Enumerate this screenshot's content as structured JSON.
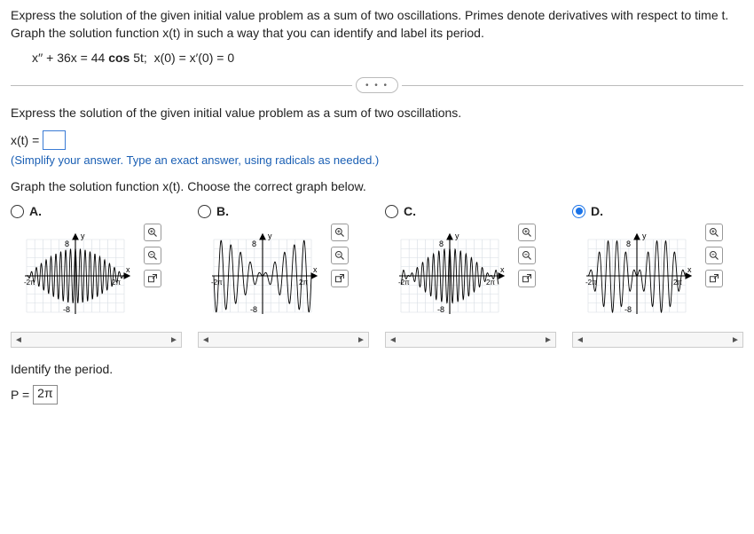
{
  "problem": {
    "statement": "Express the solution of the given initial value problem as a sum of two oscillations. Primes denote derivatives with respect to time t. Graph the solution function x(t) in such a way that you can identify and label its period.",
    "equation": "x′′ + 36x = 44 cos 5t;  x(0) = x′(0) = 0"
  },
  "more_indicator": "• • •",
  "part1": {
    "prompt": "Express the solution of the given initial value problem as a sum of two oscillations.",
    "lhs": "x(t) =",
    "answer_value": "",
    "hint": "(Simplify your answer. Type an exact answer, using radicals as needed.)"
  },
  "part2": {
    "prompt": "Graph the solution function x(t). Choose the correct graph below.",
    "options": [
      {
        "label": "A.",
        "selected": false
      },
      {
        "label": "B.",
        "selected": false
      },
      {
        "label": "C.",
        "selected": false
      },
      {
        "label": "D.",
        "selected": true
      }
    ],
    "axis": {
      "ylabel": "y",
      "xlabel": "x",
      "ytick_pos": "8",
      "ytick_neg": "-8",
      "xtick_left": "-2π",
      "xtick_right": "2π"
    }
  },
  "period": {
    "label": "Identify the period.",
    "lhs": "P =",
    "answer_value": "2π"
  },
  "tools": {
    "zoom_in": "zoom-in-icon",
    "zoom_out": "zoom-out-icon",
    "popout": "popout-icon"
  },
  "chart_data": [
    {
      "type": "line",
      "title": "Option A",
      "xlabel": "x",
      "ylabel": "y",
      "xlim_label": [
        "-2π",
        "2π"
      ],
      "ylim": [
        -8,
        8
      ],
      "x_range_num": [
        -6.283,
        6.283
      ],
      "description": "densely oscillating amplitude-modulated waveform with near-constant envelope amplitude ~6 across full range"
    },
    {
      "type": "line",
      "title": "Option B",
      "xlabel": "x",
      "ylabel": "y",
      "xlim_label": [
        "-2π",
        "2π"
      ],
      "ylim": [
        -8,
        8
      ],
      "x_range_num": [
        -6.283,
        6.283
      ],
      "description": "beating waveform, single envelope node near center, max envelope amplitude ~8 at ends"
    },
    {
      "type": "line",
      "title": "Option C",
      "xlabel": "x",
      "ylabel": "y",
      "xlim_label": [
        "-2π",
        "2π"
      ],
      "ylim": [
        -8,
        8
      ],
      "x_range_num": [
        -6.283,
        6.283
      ],
      "description": "densely oscillating amplitude-modulated waveform, envelope amplitude ~6, similar to A"
    },
    {
      "type": "line",
      "title": "Option D",
      "xlabel": "x",
      "ylabel": "y",
      "xlim_label": [
        "-2π",
        "2π"
      ],
      "ylim": [
        -8,
        8
      ],
      "x_range_num": [
        -6.283,
        6.283
      ],
      "series": [
        {
          "name": "x(t)",
          "formula": "4 cos 5t − 4 cos 6t"
        }
      ],
      "description": "beating waveform x(t)=4cos5t−4cos6t with envelope nodes at t=−2π,0,2π (period 2π), max amplitude ~8 at t=±π"
    }
  ]
}
